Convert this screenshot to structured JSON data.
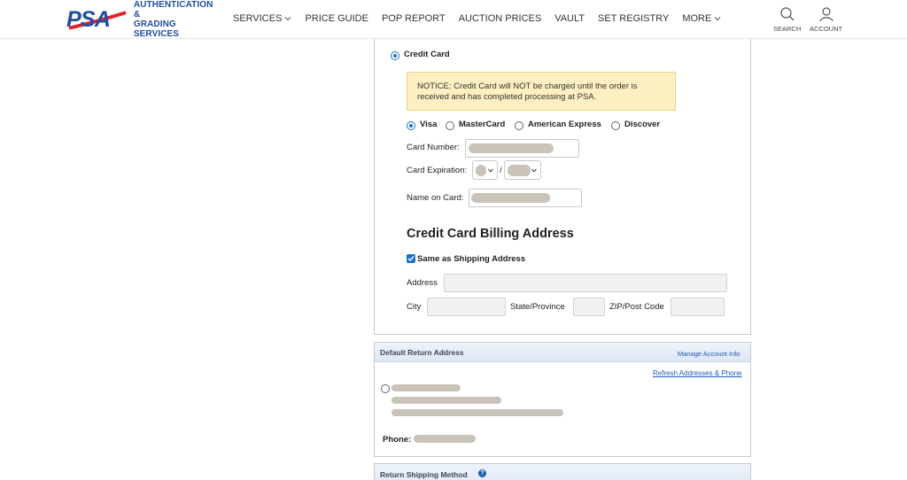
{
  "header": {
    "logo_text_line1": "AUTHENTICATION &",
    "logo_text_line2": "GRADING SERVICES",
    "nav": [
      {
        "label": "SERVICES",
        "has_dropdown": true
      },
      {
        "label": "PRICE GUIDE",
        "has_dropdown": false
      },
      {
        "label": "POP REPORT",
        "has_dropdown": false
      },
      {
        "label": "AUCTION PRICES",
        "has_dropdown": false
      },
      {
        "label": "VAULT",
        "has_dropdown": false
      },
      {
        "label": "SET REGISTRY",
        "has_dropdown": false
      },
      {
        "label": "MORE",
        "has_dropdown": true
      }
    ],
    "search_label": "SEARCH",
    "account_label": "ACCOUNT"
  },
  "payment": {
    "method_label": "Credit Card",
    "method_selected": true,
    "notice": "NOTICE: Credit Card will NOT be charged until the order is received and has completed processing at PSA.",
    "card_types": [
      {
        "label": "Visa",
        "selected": true
      },
      {
        "label": "MasterCard",
        "selected": false
      },
      {
        "label": "American Express",
        "selected": false
      },
      {
        "label": "Discover",
        "selected": false
      }
    ],
    "card_number_label": "Card Number:",
    "card_expiration_label": "Card Expiration:",
    "expiration_separator": "/",
    "name_on_card_label": "Name on Card:"
  },
  "billing": {
    "heading": "Credit Card Billing Address",
    "same_as_shipping_label": "Same as Shipping Address",
    "same_as_shipping_checked": true,
    "address_label": "Address",
    "city_label": "City",
    "state_label": "State/Province",
    "zip_label": "ZIP/Post Code"
  },
  "return_address": {
    "title": "Default Return Address",
    "manage_link": "Manage Account Info",
    "refresh_link": "Refresh Addresses & Phone",
    "phone_label": "Phone:"
  },
  "return_shipping": {
    "title": "Return Shipping Method",
    "help_icon": "?"
  },
  "colors": {
    "brand_blue": "#1f4fa0",
    "brand_red": "#e3222b",
    "accent_blue": "#1a73c9",
    "notice_bg": "#fcefc1"
  }
}
